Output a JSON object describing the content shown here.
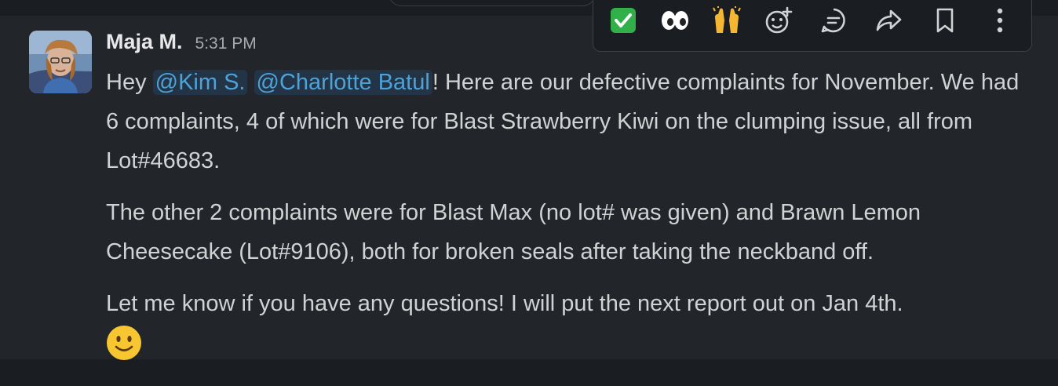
{
  "message": {
    "author": "Maja M.",
    "time": "5:31 PM",
    "greeting": "Hey ",
    "mentions": [
      "@Kim S.",
      "@Charlotte Batul"
    ],
    "p1_after_mentions": "! Here are our defective complaints for November. We had 6 complaints, 4 of which were for Blast Strawberry Kiwi on the clumping issue, all from Lot#46683.",
    "p2": "The other 2 complaints were for Blast Max (no lot# was given) and Brawn Lemon Cheesecake (Lot#9106), both for broken seals after taking the neckband off.",
    "p3": "Let me know if you have any questions! I will put the next report out on Jan 4th."
  },
  "actions": [
    {
      "icon": "white-check-mark-icon"
    },
    {
      "icon": "eyes-icon"
    },
    {
      "icon": "raised-hands-icon"
    },
    {
      "icon": "add-reaction-icon"
    },
    {
      "icon": "reply-in-thread-icon"
    },
    {
      "icon": "share-icon"
    },
    {
      "icon": "bookmark-icon"
    },
    {
      "icon": "more-actions-icon"
    }
  ],
  "colors": {
    "background": "#222529",
    "mention_text": "#4da3d8",
    "mention_bg": "#233447",
    "text": "#d1d2d3"
  }
}
